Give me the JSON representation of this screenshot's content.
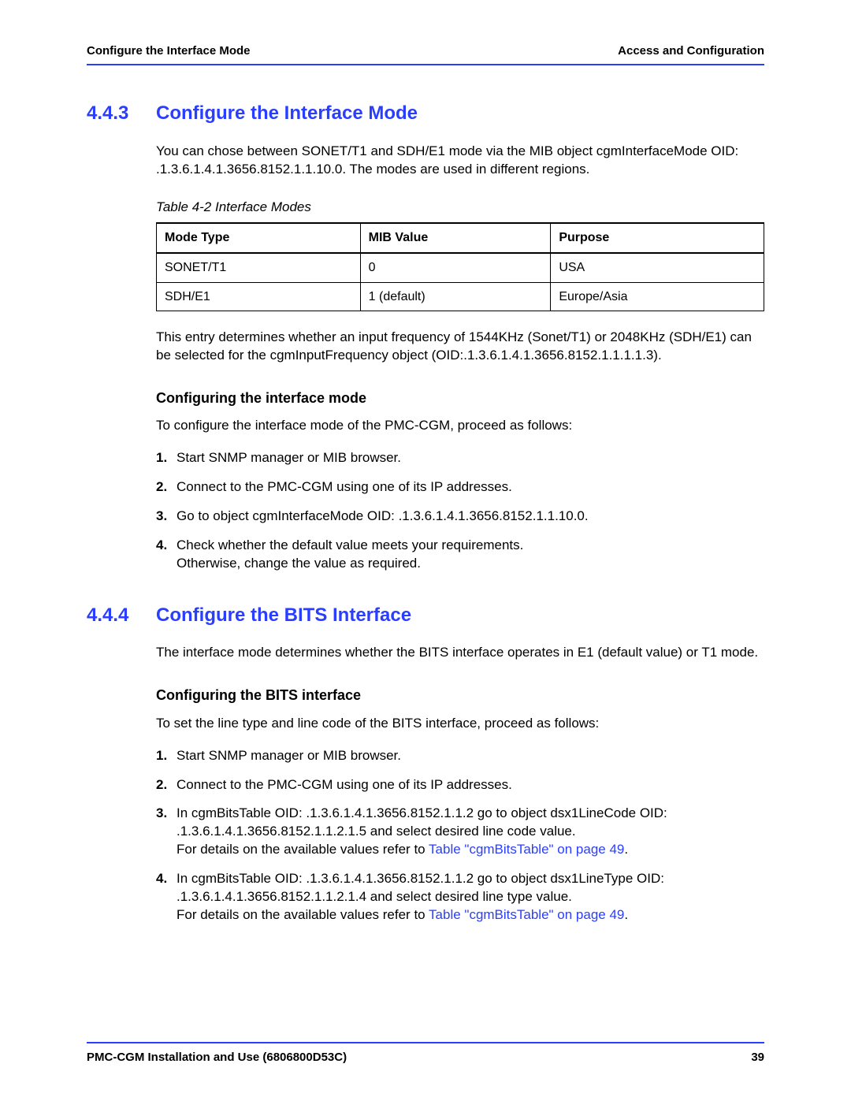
{
  "header": {
    "left": "Configure the Interface Mode",
    "right": "Access and Configuration"
  },
  "sec443": {
    "num": "4.4.3",
    "title": "Configure the Interface Mode",
    "intro": "You can chose between SONET/T1 and SDH/E1 mode via the MIB object cgmInterfaceMode OID: .1.3.6.1.4.1.3656.8152.1.1.10.0. The modes are used in different regions.",
    "table_caption": "Table 4-2 Interface Modes",
    "table": {
      "headers": [
        "Mode Type",
        "MIB Value",
        "Purpose"
      ],
      "rows": [
        [
          "SONET/T1",
          "0",
          "USA"
        ],
        [
          "SDH/E1",
          "1 (default)",
          "Europe/Asia"
        ]
      ]
    },
    "after_table": "This entry determines whether an input frequency of 1544KHz (Sonet/T1) or 2048KHz (SDH/E1) can be selected for the cgmInputFrequency object (OID:.1.3.6.1.4.1.3656.8152.1.1.1.1.3).",
    "sub_head": "Configuring the interface mode",
    "sub_intro": "To configure the interface mode of the PMC-CGM, proceed as follows:",
    "steps": [
      "Start SNMP manager or MIB browser.",
      "Connect to the PMC-CGM using one of its IP addresses.",
      "Go to object cgmInterfaceMode OID: .1.3.6.1.4.1.3656.8152.1.1.10.0.",
      "Check whether the default value meets your requirements.\nOtherwise, change the value as required."
    ]
  },
  "sec444": {
    "num": "4.4.4",
    "title": "Configure the BITS Interface",
    "intro": "The interface mode determines whether the BITS interface operates in E1 (default value) or T1 mode.",
    "sub_head": "Configuring the BITS interface",
    "sub_intro": "To set the line type and line code of the BITS interface, proceed as follows:",
    "steps": [
      {
        "text": "Start SNMP manager or MIB browser."
      },
      {
        "text": "Connect to the PMC-CGM using one of its IP addresses."
      },
      {
        "pre": "In cgmBitsTable OID: .1.3.6.1.4.1.3656.8152.1.1.2 go to object dsx1LineCode OID: .1.3.6.1.4.1.3656.8152.1.1.2.1.5 and select desired line code value.\nFor details on the available values refer to ",
        "link": "Table \"cgmBitsTable\" on page 49",
        "post": "."
      },
      {
        "pre": "In cgmBitsTable OID: .1.3.6.1.4.1.3656.8152.1.1.2 go to object dsx1LineType OID: .1.3.6.1.4.1.3656.8152.1.1.2.1.4 and select desired line type value.\nFor details on the available values refer to ",
        "link": "Table \"cgmBitsTable\" on page 49",
        "post": "."
      }
    ]
  },
  "footer": {
    "left": "PMC-CGM Installation and Use (6806800D53C)",
    "right": "39"
  }
}
